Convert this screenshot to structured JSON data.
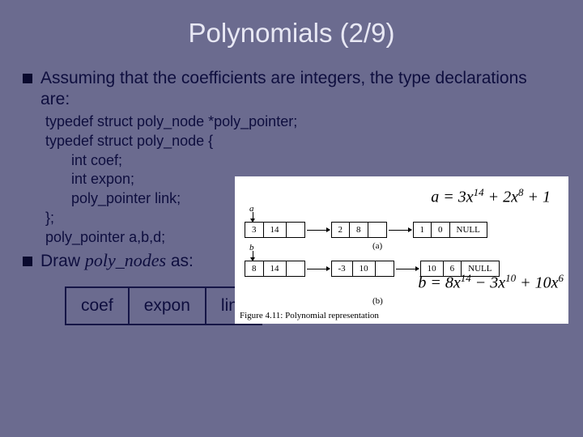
{
  "title": "Polynomials (2/9)",
  "bullet1": "Assuming that the coefficients are integers, the type declarations are:",
  "code": {
    "l1": "typedef struct poly_node *poly_pointer;",
    "l2": "typedef struct poly_node {",
    "l3": "int coef;",
    "l4": "int expon;",
    "l5": "poly_pointer link;",
    "l6": "};",
    "l7": "poly_pointer a,b,d;"
  },
  "bullet2_pre": "Draw ",
  "bullet2_italic": "poly_nodes",
  "bullet2_post": " as:",
  "table": {
    "c1": "coef",
    "c2": "expon",
    "c3": "link"
  },
  "figure": {
    "a_label": "a",
    "b_label": "b",
    "sub_a": "(a)",
    "sub_b": "(b)",
    "caption": "Figure 4.11: Polynomial representation",
    "null": "NULL",
    "eqA": {
      "lhs": "a = 3x",
      "e1": "14",
      "m1": " + 2x",
      "e2": "8",
      "tail": " + 1"
    },
    "eqB": {
      "lhs": "b = 8x",
      "e1": "14",
      "m1": " − 3x",
      "e2": "10",
      "m2": " + 10x",
      "e3": "6"
    },
    "rowA": [
      {
        "coef": "3",
        "expon": "14"
      },
      {
        "coef": "2",
        "expon": "8"
      },
      {
        "coef": "1",
        "expon": "0"
      }
    ],
    "rowB": [
      {
        "coef": "8",
        "expon": "14"
      },
      {
        "coef": "-3",
        "expon": "10"
      },
      {
        "coef": "10",
        "expon": "6"
      }
    ]
  }
}
